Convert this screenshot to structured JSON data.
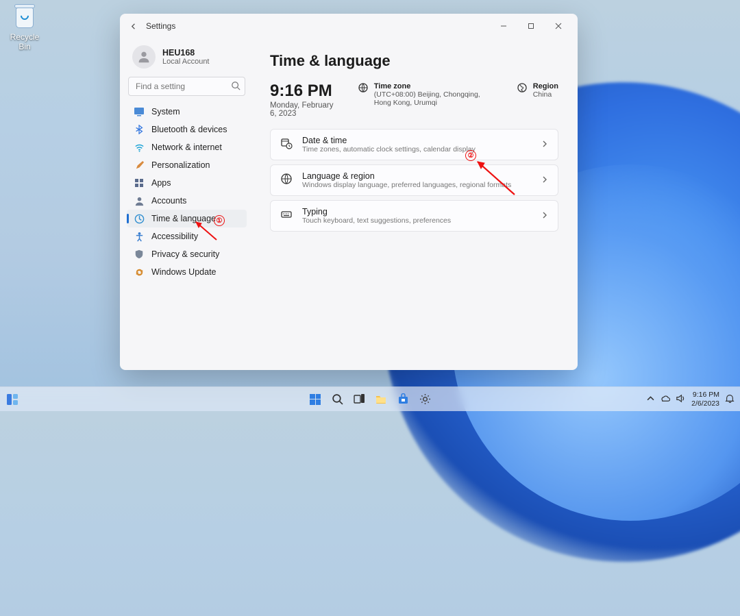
{
  "desktop": {
    "recycle_bin": "Recycle Bin"
  },
  "window": {
    "app_name": "Settings",
    "account": {
      "name": "HEU168",
      "sub": "Local Account"
    },
    "search_placeholder": "Find a setting",
    "nav": [
      {
        "label": "System"
      },
      {
        "label": "Bluetooth & devices"
      },
      {
        "label": "Network & internet"
      },
      {
        "label": "Personalization"
      },
      {
        "label": "Apps"
      },
      {
        "label": "Accounts"
      },
      {
        "label": "Time & language",
        "active": true
      },
      {
        "label": "Accessibility"
      },
      {
        "label": "Privacy & security"
      },
      {
        "label": "Windows Update"
      }
    ],
    "page_title": "Time & language",
    "clock": {
      "time": "9:16 PM",
      "date": "Monday, February 6, 2023"
    },
    "timezone": {
      "label": "Time zone",
      "value": "(UTC+08:00) Beijing, Chongqing, Hong Kong, Urumqi"
    },
    "region": {
      "label": "Region",
      "value": "China"
    },
    "cards": [
      {
        "title": "Date & time",
        "sub": "Time zones, automatic clock settings, calendar display"
      },
      {
        "title": "Language & region",
        "sub": "Windows display language, preferred languages, regional formats"
      },
      {
        "title": "Typing",
        "sub": "Touch keyboard, text suggestions, preferences"
      }
    ]
  },
  "annotations": {
    "mark1": "①",
    "mark2": "②"
  },
  "taskbar": {
    "time": "9:16 PM",
    "date": "2/6/2023"
  }
}
